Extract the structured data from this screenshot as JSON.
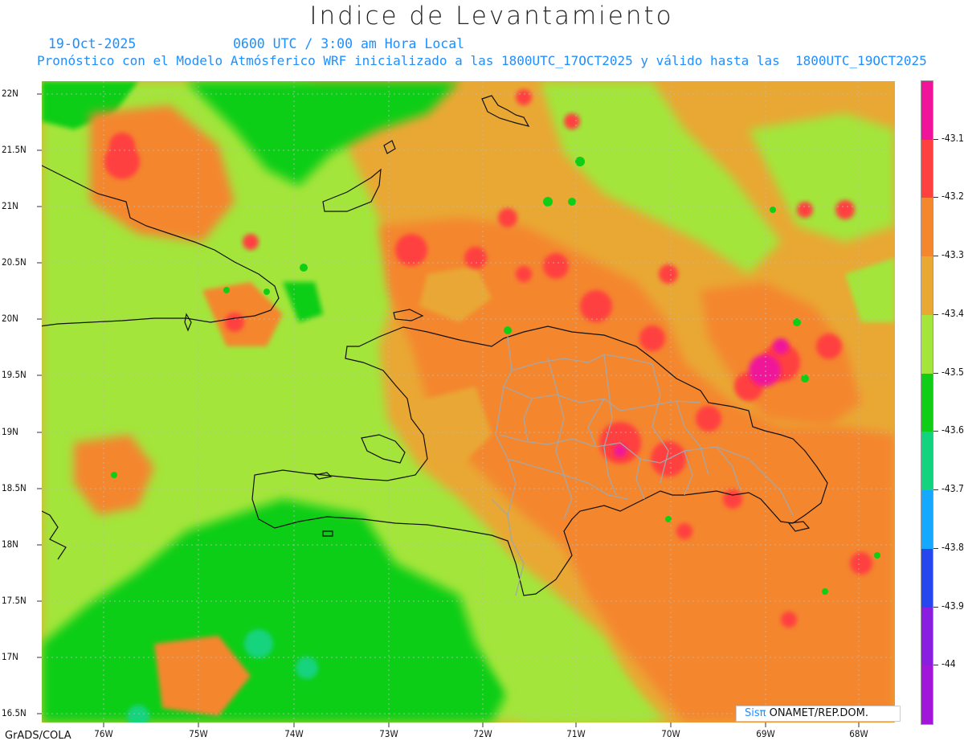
{
  "title": "Indice de Levantamiento",
  "date": "19-Oct-2025",
  "valid_time": "0600 UTC / 3:00 am Hora Local",
  "forecast_info": "Pronóstico con el Modelo Atmósferico WRF inicializado a las 1800UTC_17OCT2025 y válido hasta las  1800UTC_19OCT2025",
  "lat_labels": [
    "22N",
    "21.5N",
    "21N",
    "20.5N",
    "20N",
    "19.5N",
    "19N",
    "18.5N",
    "18N",
    "17.5N",
    "17N",
    "16.5N"
  ],
  "lon_labels": [
    "76W",
    "75W",
    "74W",
    "73W",
    "72W",
    "71W",
    "70W",
    "69W",
    "68W"
  ],
  "legend": {
    "labels": [
      "-43.1",
      "-43.2",
      "-43.3",
      "-43.4",
      "-43.5",
      "-43.6",
      "-43.7",
      "-43.8",
      "-43.9",
      "-44"
    ],
    "colors": [
      "#f0149a",
      "#ff4040",
      "#f4862e",
      "#e9a834",
      "#a3e53a",
      "#0fce15",
      "#12d37e",
      "#14a8ff",
      "#2646f0",
      "#8a1ee0",
      "#a116d8"
    ]
  },
  "field_colors": {
    "green": "#0fce15",
    "light_green": "#a3e53a",
    "orange_light": "#e9a834",
    "orange": "#f4862e",
    "red": "#ff4040",
    "magenta": "#f0149a",
    "teal": "#12d37e"
  },
  "credit": {
    "logo": "Sisπ",
    "text": " ONAMET/REP.DOM."
  },
  "footer": "GrADS/COLA"
}
